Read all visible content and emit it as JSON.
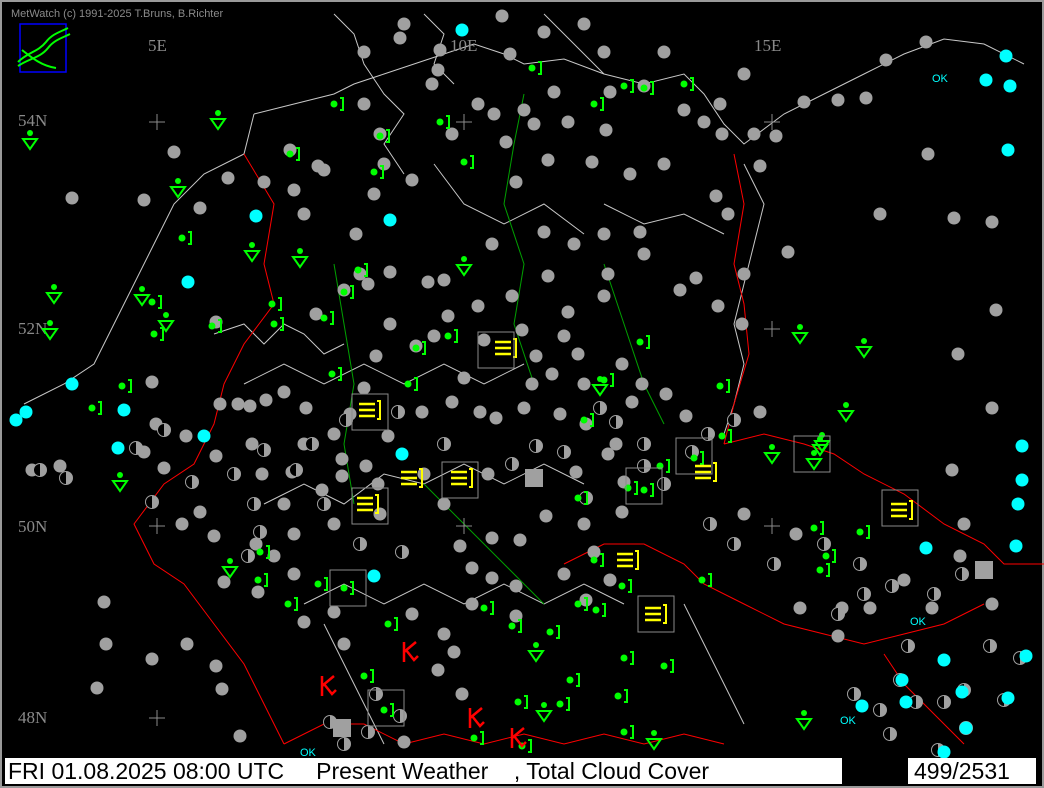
{
  "app": {
    "credit": "MetWatch  (c) 1991-2025 T.Bruns, B.Richter",
    "logo_icon": "metwatch-logo-icon"
  },
  "map": {
    "longitude_labels": [
      "5E",
      "10E",
      "15E"
    ],
    "latitude_labels": [
      "54N",
      "52N",
      "50N",
      "48N"
    ],
    "ok_label": "OK",
    "colors": {
      "background": "#000000",
      "coastline_and_borders": "#c8c8c8",
      "national_border": "#ff0000",
      "rivers": "#00a000",
      "cloud_cover_symbol": "#a0a0a0",
      "precipitation_symbol": "#00ff00",
      "fog_symbol": "#ffff00",
      "thunderstorm_symbol": "#ff0000",
      "clear_sky_symbol": "#00ffff"
    }
  },
  "footer": {
    "datetime_label": "FRI 01.08.2025 08:00 UTC",
    "product_label": "Present Weather",
    "secondary_label": ", Total Cloud Cover",
    "station_count": "499/2531"
  }
}
